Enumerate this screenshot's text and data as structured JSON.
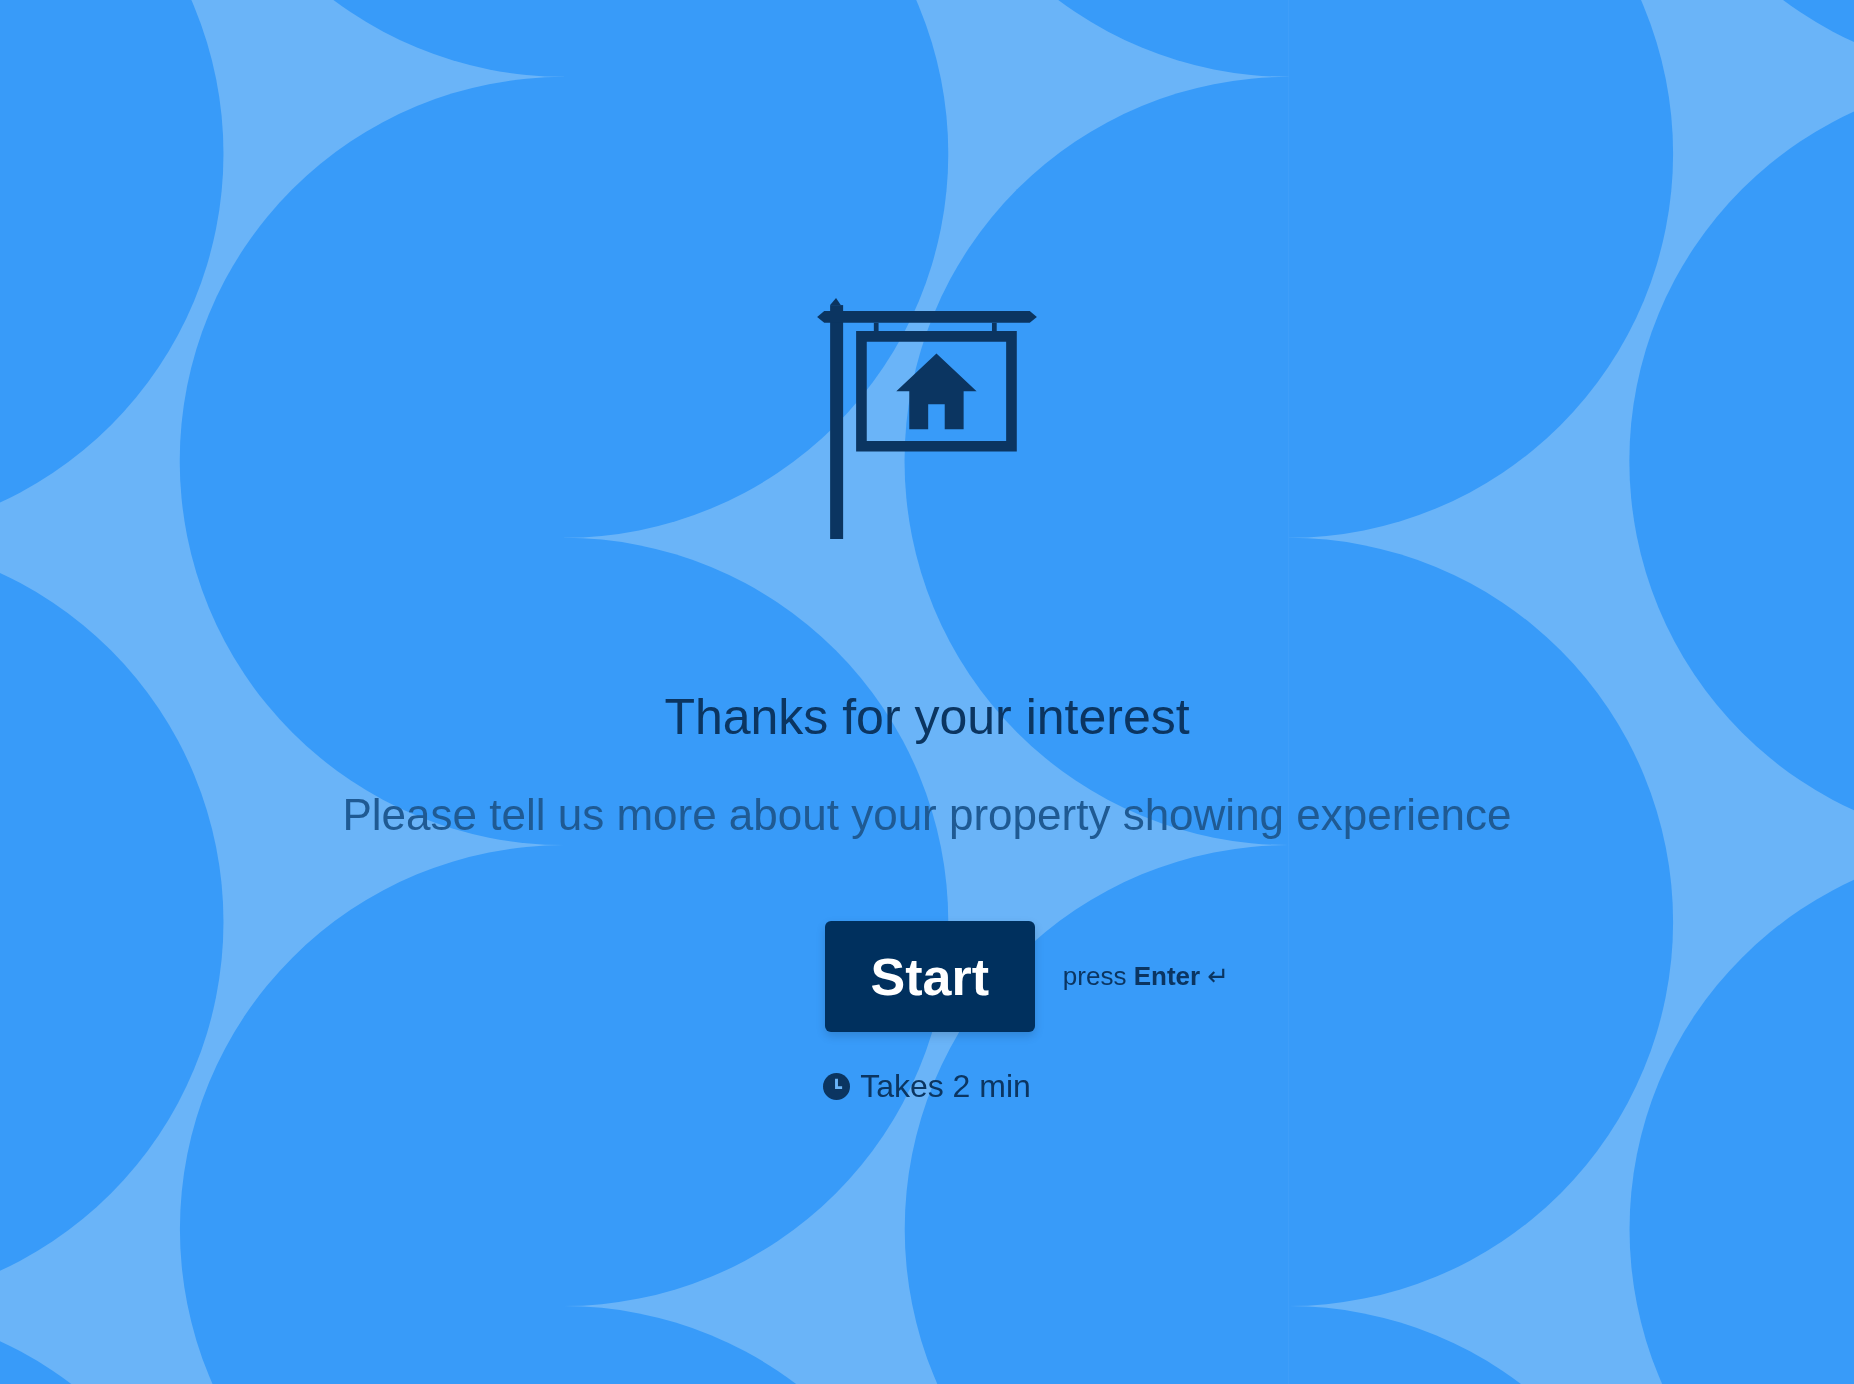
{
  "title": "Thanks for your interest",
  "subtitle": "Please tell us more about your property showing experience",
  "start_button": "Start",
  "hint": "press **Enter** ↵",
  "duration": "Takes 2 min"
}
